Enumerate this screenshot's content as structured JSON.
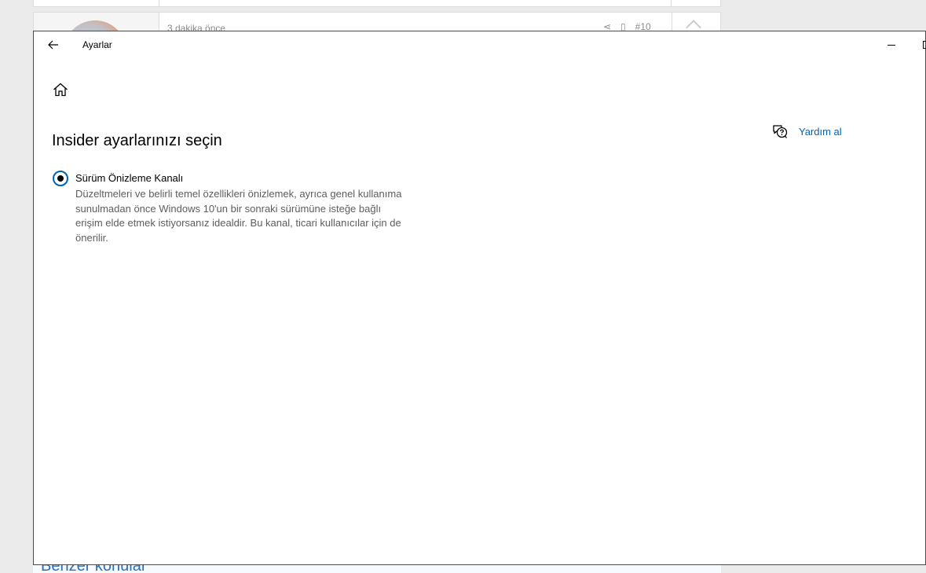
{
  "background": {
    "post_time": "3 dakika önce",
    "post_number": "#10",
    "similar_topics": "Benzer konular"
  },
  "window": {
    "title": "Ayarlar"
  },
  "page": {
    "title": "Insider ayarlarınızı seçin",
    "help_label": "Yardım al",
    "option": {
      "label": "Sürüm Önizleme Kanalı",
      "selected": true,
      "description": "Düzeltmeleri ve belirli temel özellikleri önizlemek, ayrıca genel kullanıma sunulmadan önce Windows 10'un bir sonraki sürümüne isteğe bağlı erişim elde etmek istiyorsanız idealdir. Bu kanal, ticari kullanıcılar için de önerilir."
    }
  },
  "colors": {
    "accent": "#0063b1",
    "window_border": "#4a4a4a",
    "secondary_text": "#5d5d5d"
  },
  "icons": {
    "back": "back-arrow-icon",
    "home": "home-icon",
    "help": "chat-help-icon",
    "minimize": "minimize-icon",
    "maximize": "maximize-icon"
  }
}
